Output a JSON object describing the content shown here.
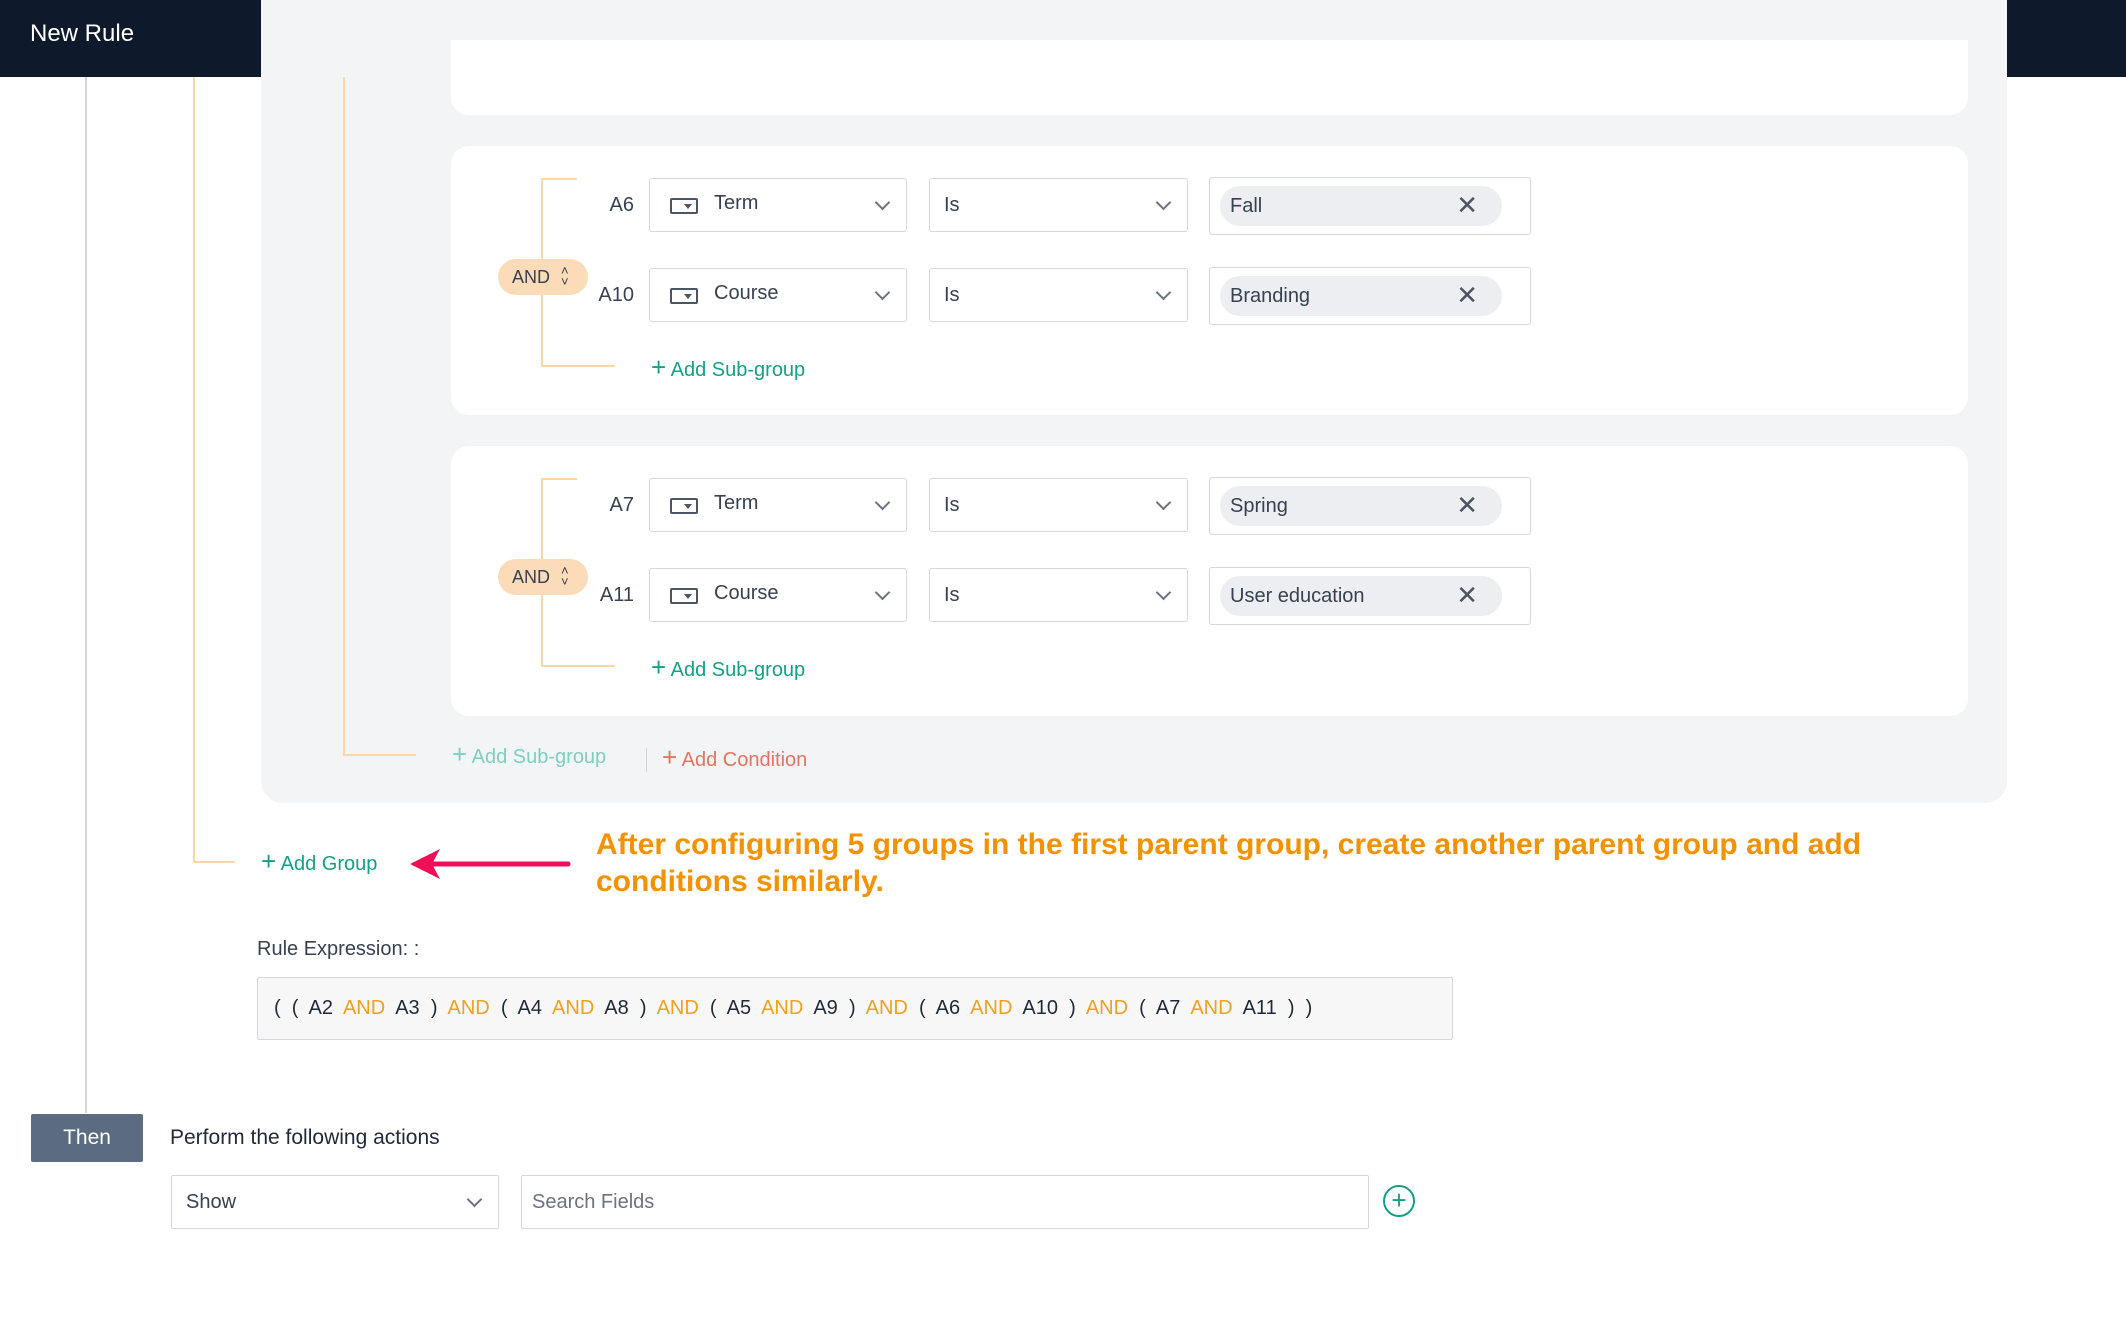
{
  "header": {
    "title": "New Rule"
  },
  "groups": [
    {
      "operator": "AND",
      "conditions": [
        {
          "id": "A6",
          "field": "Term",
          "op": "Is",
          "value": "Fall"
        },
        {
          "id": "A10",
          "field": "Course",
          "op": "Is",
          "value": "Branding"
        }
      ],
      "add_subgroup": "Add Sub-group"
    },
    {
      "operator": "AND",
      "conditions": [
        {
          "id": "A7",
          "field": "Term",
          "op": "Is",
          "value": "Spring"
        },
        {
          "id": "A11",
          "field": "Course",
          "op": "Is",
          "value": "User education"
        }
      ],
      "add_subgroup": "Add Sub-group"
    }
  ],
  "parent_actions": {
    "add_subgroup": "Add Sub-group",
    "add_condition": "Add Condition"
  },
  "add_group": "Add Group",
  "annotation": {
    "line1": "After configuring 5 groups in the first parent group, create another parent group and add",
    "line2": "conditions similarly.",
    "color": "#f39200",
    "arrow_color": "#f0105a"
  },
  "rule_expression": {
    "label": "Rule Expression: :",
    "tokens": [
      "(",
      "(",
      "A2",
      "AND",
      "A3",
      ")",
      "AND",
      "(",
      "A4",
      "AND",
      "A8",
      ")",
      "AND",
      "(",
      "A5",
      "AND",
      "A9",
      ")",
      "AND",
      "(",
      "A6",
      "AND",
      "A10",
      ")",
      "AND",
      "(",
      "A7",
      "AND",
      "A11",
      ")",
      ")"
    ]
  },
  "then": {
    "button_label": "Then",
    "title": "Perform the following actions",
    "action_select": "Show",
    "search_placeholder": "Search Fields",
    "add_icon": "+"
  },
  "icons": {
    "close": "✕",
    "add": "+",
    "sort": "⌃⌄"
  },
  "colors": {
    "header_bg": "#0e1a2b",
    "green": "#14a085",
    "orange": "#f39200",
    "coral": "#e4745f",
    "and_pill": "#fcdcb8"
  }
}
